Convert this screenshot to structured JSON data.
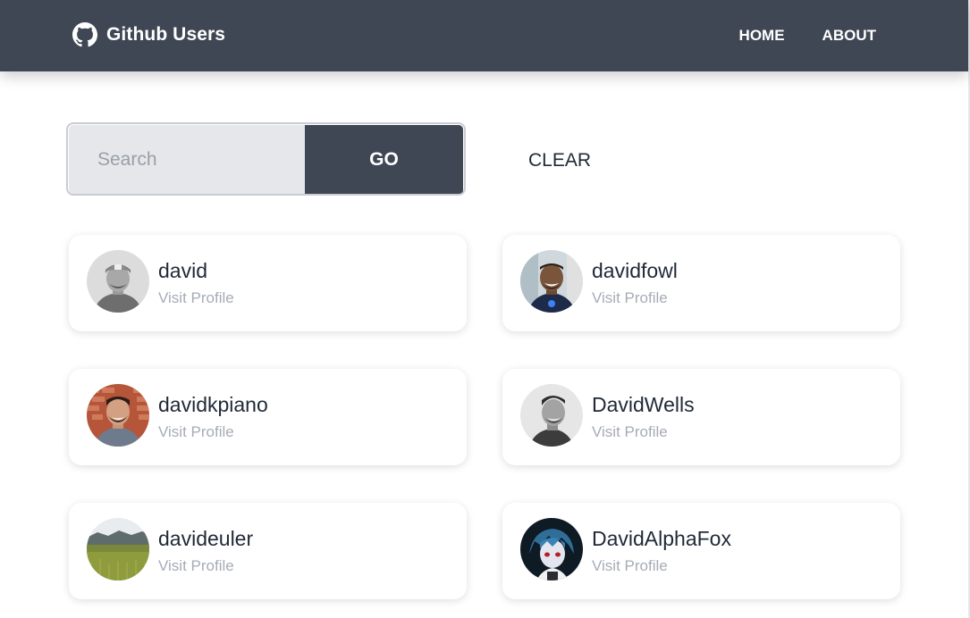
{
  "header": {
    "title": "Github Users",
    "brand_icon": "github-icon",
    "nav": [
      {
        "label": "HOME"
      },
      {
        "label": "ABOUT"
      }
    ],
    "background": "#3f4654"
  },
  "search": {
    "placeholder": "Search",
    "value": "",
    "go_label": "GO",
    "clear_label": "CLEAR"
  },
  "users": [
    {
      "login": "david",
      "link_text": "Visit Profile",
      "avatar": "avatar-man-gray-cap"
    },
    {
      "login": "davidfowl",
      "link_text": "Visit Profile",
      "avatar": "avatar-man-smiling-dark"
    },
    {
      "login": "davidkpiano",
      "link_text": "Visit Profile",
      "avatar": "avatar-man-brick-wall"
    },
    {
      "login": "DavidWells",
      "link_text": "Visit Profile",
      "avatar": "avatar-man-grayscale"
    },
    {
      "login": "davideuler",
      "link_text": "Visit Profile",
      "avatar": "avatar-landscape-field"
    },
    {
      "login": "DavidAlphaFox",
      "link_text": "Visit Profile",
      "avatar": "avatar-anime-character"
    }
  ]
}
